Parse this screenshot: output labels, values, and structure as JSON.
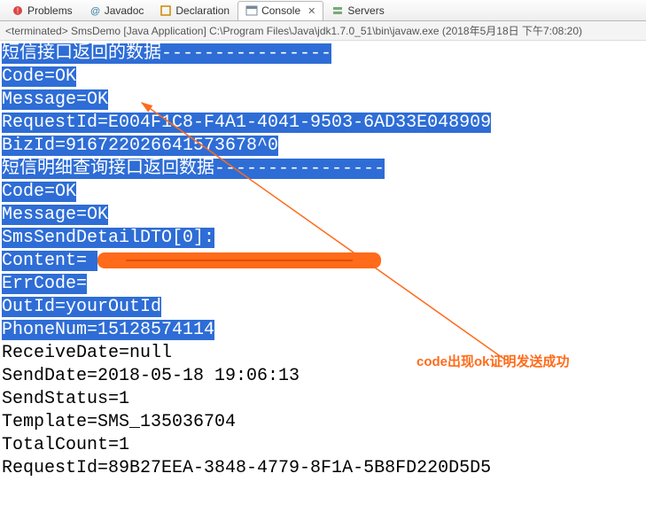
{
  "tabs": {
    "problems": "Problems",
    "javadoc": "Javadoc",
    "declaration": "Declaration",
    "console": "Console",
    "servers": "Servers"
  },
  "status": "<terminated> SmsDemo [Java Application] C:\\Program Files\\Java\\jdk1.7.0_51\\bin\\javaw.exe (2018年5月18日 下午7:08:20)",
  "lines": {
    "l0": "短信接口返回的数据----------------",
    "l1": "Code=OK",
    "l2": "Message=OK",
    "l3": "RequestId=E004F1C8-F4A1-4041-9503-6AD33E048909",
    "l4": "BizId=916722026641573678^0",
    "l5": "短信明细查询接口返回数据----------------",
    "l6": "Code=OK",
    "l7": "Message=OK",
    "l8": "SmsSendDetailDTO[0]:",
    "l9": "Content=",
    "l10": "ErrCode=",
    "l11": "OutId=yourOutId",
    "l12": "PhoneNum=15128574114",
    "l13": "ReceiveDate=null",
    "l14": "SendDate=2018-05-18 19:06:13",
    "l15": "SendStatus=1",
    "l16": "Template=SMS_135036704",
    "l17": "TotalCount=1",
    "l18": "RequestId=89B27EEA-3848-4779-8F1A-5B8FD220D5D5"
  },
  "annotation": "code出现ok证明发送成功"
}
